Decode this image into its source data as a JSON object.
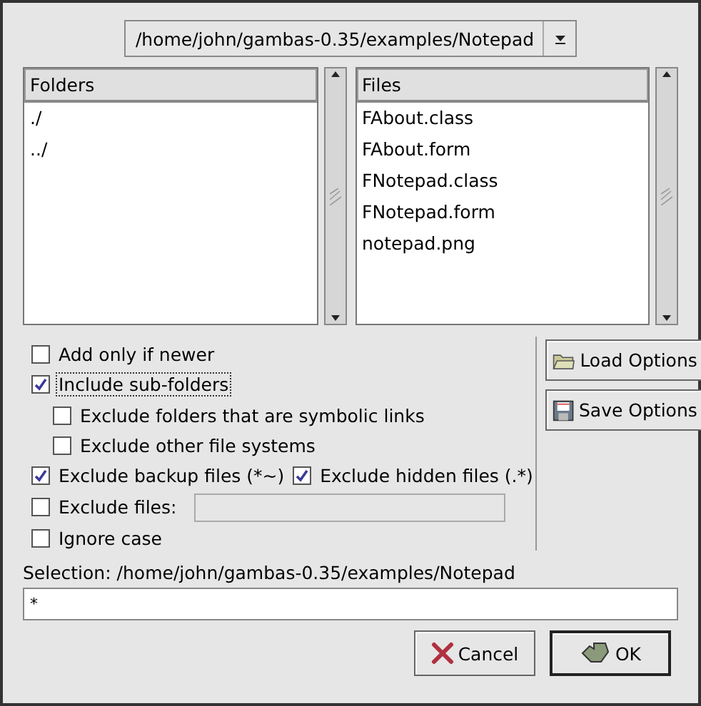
{
  "path_combo": {
    "value": "/home/john/gambas-0.35/examples/Notepad"
  },
  "folders": {
    "header": "Folders",
    "items": [
      {
        "label": "./"
      },
      {
        "label": "../"
      }
    ]
  },
  "files": {
    "header": "Files",
    "items": [
      {
        "label": "FAbout.class"
      },
      {
        "label": "FAbout.form"
      },
      {
        "label": "FNotepad.class"
      },
      {
        "label": "FNotepad.form"
      },
      {
        "label": "notepad.png"
      }
    ]
  },
  "options": [
    {
      "kind": "check",
      "label": "Add only if newer",
      "checked": false,
      "focused": false
    },
    {
      "kind": "check",
      "label": "Include sub-folders",
      "checked": true,
      "focused": true,
      "children": [
        {
          "kind": "check",
          "label": "Exclude folders that are symbolic links",
          "checked": false,
          "focused": false
        },
        {
          "kind": "check",
          "label": "Exclude other file systems",
          "checked": false,
          "focused": false
        }
      ]
    },
    {
      "kind": "pair",
      "items": [
        {
          "label": "Exclude backup files (*~)",
          "checked": true,
          "focused": false
        },
        {
          "label": "Exclude hidden files (.*)",
          "checked": true,
          "focused": false
        }
      ]
    },
    {
      "kind": "field",
      "label": "Exclude files:",
      "checked": false,
      "focused": false
    },
    {
      "kind": "check",
      "label": "Ignore case",
      "checked": false,
      "focused": false
    }
  ],
  "side_buttons": [
    {
      "kind": "load",
      "label": "Load Options"
    },
    {
      "kind": "save",
      "label": "Save Options"
    }
  ],
  "selection": {
    "label": "Selection: /home/john/gambas-0.35/examples/Notepad",
    "value": "*"
  },
  "buttons": [
    {
      "kind": "cancel",
      "label": "Cancel"
    },
    {
      "kind": "ok",
      "label": "OK"
    }
  ]
}
